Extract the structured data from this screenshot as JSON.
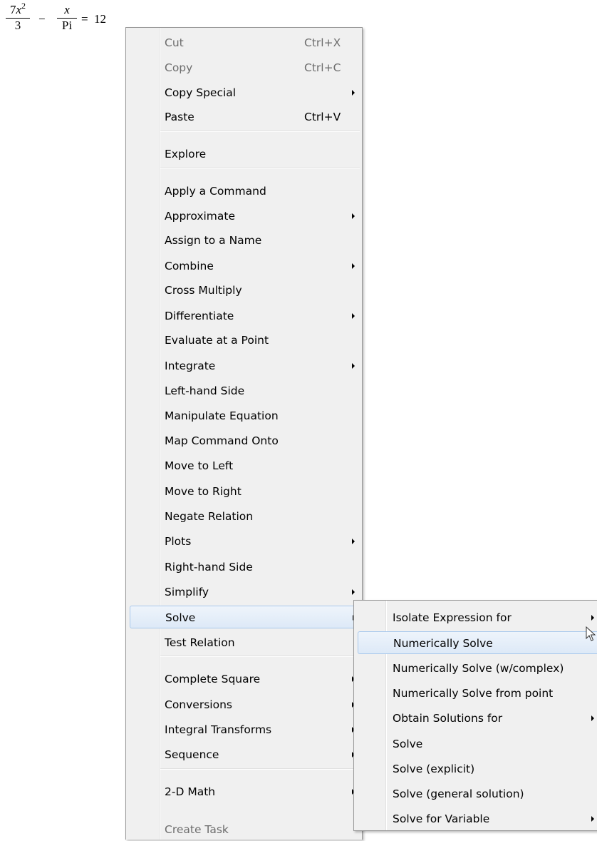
{
  "expression": {
    "frac1": {
      "numerator_coef": "7",
      "numerator_var": "x",
      "numerator_exp": "2",
      "denominator": "3"
    },
    "minus": "−",
    "frac2": {
      "numerator": "x",
      "denominator": "Pi"
    },
    "equals": "=",
    "rhs": "12"
  },
  "context_menu": {
    "items": [
      {
        "label": "Cut",
        "shortcut": "Ctrl+X",
        "disabled": true
      },
      {
        "label": "Copy",
        "shortcut": "Ctrl+C",
        "disabled": true
      },
      {
        "label": "Copy Special",
        "submenu": true
      },
      {
        "label": "Paste",
        "shortcut": "Ctrl+V"
      },
      {
        "label": "Explore"
      },
      {
        "label": "Apply a Command"
      },
      {
        "label": "Approximate",
        "submenu": true
      },
      {
        "label": "Assign to a Name"
      },
      {
        "label": "Combine",
        "submenu": true
      },
      {
        "label": "Cross Multiply"
      },
      {
        "label": "Differentiate",
        "submenu": true
      },
      {
        "label": "Evaluate at a Point"
      },
      {
        "label": "Integrate",
        "submenu": true
      },
      {
        "label": "Left-hand Side"
      },
      {
        "label": "Manipulate Equation"
      },
      {
        "label": "Map Command Onto"
      },
      {
        "label": "Move to Left"
      },
      {
        "label": "Move to Right"
      },
      {
        "label": "Negate Relation"
      },
      {
        "label": "Plots",
        "submenu": true
      },
      {
        "label": "Right-hand Side"
      },
      {
        "label": "Simplify",
        "submenu": true
      },
      {
        "label": "Solve",
        "submenu": true,
        "highlighted": true
      },
      {
        "label": "Test Relation"
      },
      {
        "label": "Complete Square",
        "submenu": true
      },
      {
        "label": "Conversions",
        "submenu": true
      },
      {
        "label": "Integral Transforms",
        "submenu": true
      },
      {
        "label": "Sequence",
        "submenu": true
      },
      {
        "label": "2-D Math",
        "submenu": true
      },
      {
        "label": "Create Task",
        "disabled": true
      }
    ]
  },
  "solve_submenu": {
    "items": [
      {
        "label": "Isolate Expression for",
        "submenu": true
      },
      {
        "label": "Numerically Solve",
        "highlighted": true
      },
      {
        "label": "Numerically Solve (w/complex)"
      },
      {
        "label": "Numerically Solve from point"
      },
      {
        "label": "Obtain Solutions for",
        "submenu": true
      },
      {
        "label": "Solve"
      },
      {
        "label": "Solve (explicit)"
      },
      {
        "label": "Solve (general solution)"
      },
      {
        "label": "Solve for Variable",
        "submenu": true
      }
    ]
  }
}
